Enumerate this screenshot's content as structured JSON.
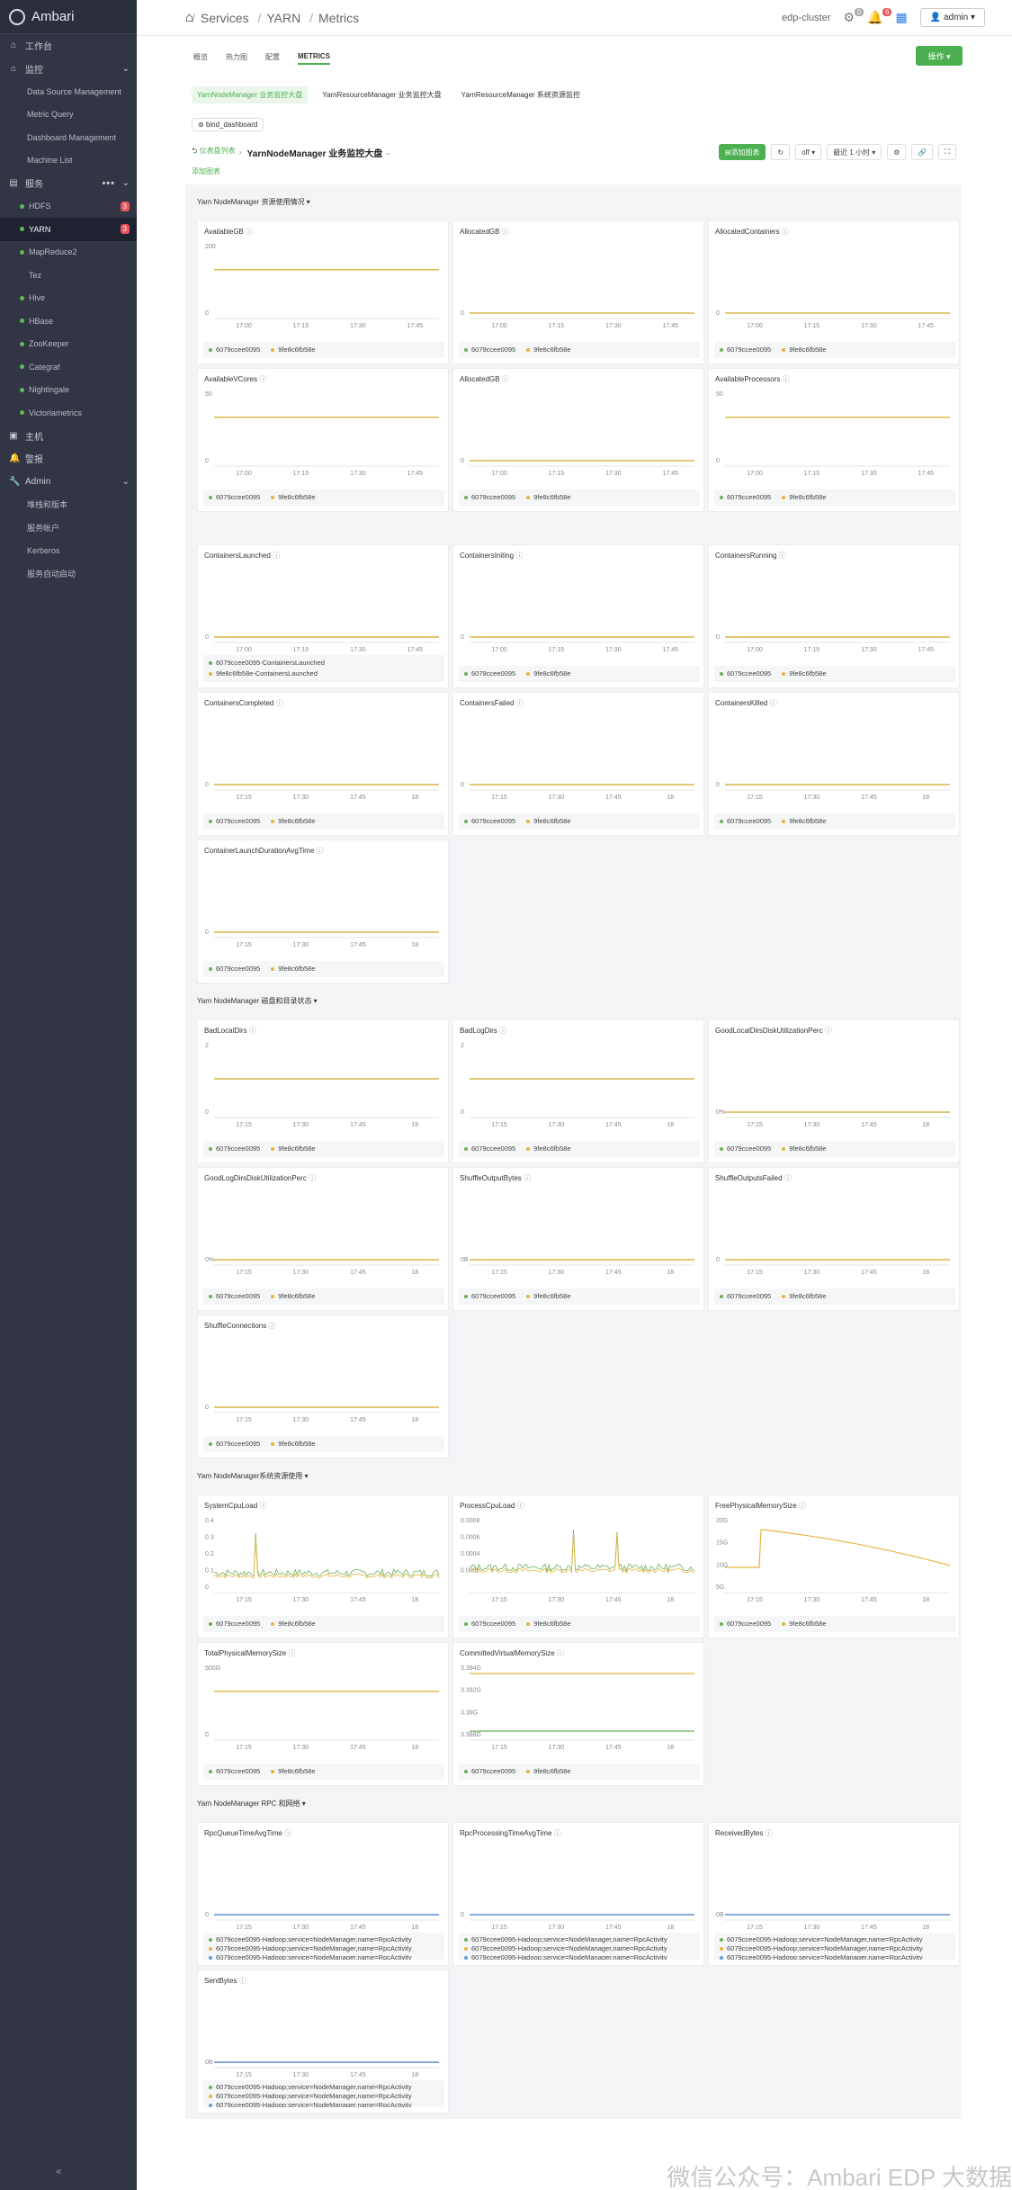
{
  "app": {
    "name": "Ambari"
  },
  "sidebar": {
    "items": [
      {
        "label": "工作台",
        "icon": "dashboard-icon"
      },
      {
        "label": "监控",
        "icon": "home-icon",
        "expanded": true
      },
      {
        "label": "Data Source Management",
        "type": "sub"
      },
      {
        "label": "Metric Query",
        "type": "sub"
      },
      {
        "label": "Dashboard Management",
        "type": "sub"
      },
      {
        "label": "Machine List",
        "type": "sub"
      },
      {
        "label": "服务",
        "icon": "services-icon",
        "expanded": true
      },
      {
        "label": "HDFS",
        "type": "svc",
        "badge": "3"
      },
      {
        "label": "YARN",
        "type": "svc",
        "badge": "3",
        "active": true
      },
      {
        "label": "MapReduce2",
        "type": "svc"
      },
      {
        "label": "Tez",
        "type": "svc",
        "nodot": true
      },
      {
        "label": "Hive",
        "type": "svc"
      },
      {
        "label": "HBase",
        "type": "svc"
      },
      {
        "label": "ZooKeeper",
        "type": "svc"
      },
      {
        "label": "Categraf",
        "type": "svc"
      },
      {
        "label": "Nightingale",
        "type": "svc"
      },
      {
        "label": "Victoriametrics",
        "type": "svc"
      },
      {
        "label": "主机",
        "icon": "host-icon"
      },
      {
        "label": "警报",
        "icon": "alert-icon"
      },
      {
        "label": "Admin",
        "icon": "wrench-icon",
        "expanded": true
      },
      {
        "label": "堆栈和版本",
        "type": "sub"
      },
      {
        "label": "服务帐户",
        "type": "sub"
      },
      {
        "label": "Kerberos",
        "type": "sub"
      },
      {
        "label": "服务自动启动",
        "type": "sub"
      }
    ],
    "collapse": "«"
  },
  "header": {
    "breadcrumb": [
      "Services",
      "YARN",
      "Metrics"
    ],
    "cluster": "edp-cluster",
    "settings_badge": "0",
    "alerts_badge": "6",
    "user": "admin ▾"
  },
  "tabs": [
    "概览",
    "热力图",
    "配置",
    "METRICS"
  ],
  "ops_button": "操作 ▾",
  "subtabs": [
    "YarnNodeManager 业务监控大盘",
    "YarnResourceManager 业务监控大盘",
    "YarnResourceManager 系统资源监控"
  ],
  "bind_tag": "bind_dashboard",
  "dashbar": {
    "back": "仪表盘列表",
    "arrow": "›",
    "title": "YarnNodeManager 业务监控大盘",
    "add_panel": "添加图表",
    "refresh_off": "off ▾",
    "time_range": "最近 1 小时 ▾"
  },
  "add_chart": "添加图表",
  "colors": {
    "series1": "#6fae5a",
    "series2": "#e6b33d",
    "series3": "#5aa0d8",
    "blue_line": "#3f76c4",
    "accent": "#4caf50"
  },
  "groups": [
    {
      "title": "Yarn NodeManager 资源使用情况 ▾"
    },
    {
      "title": "Yarn NodeManager 磁盘和目录状态 ▾"
    },
    {
      "title": "Yarn NodeManager系统资源使用 ▾"
    },
    {
      "title": "Yarn NodeManager RPC 和网络 ▾"
    }
  ],
  "legend_sets": {
    "std": [
      "6079ccee0095",
      "9fe8c6fb58e"
    ],
    "cl": [
      "6079ccee0095-ContainersLaunched",
      "9fe8c6fb58e-ContainersLaunched"
    ],
    "rpc": [
      "6079ccee0095-Hadoop;service=NodeManager,name=RpcActivity",
      "6079ccee0095-Hadoop;service=NodeManager,name=RpcActivity",
      "6079ccee0095-Hadoop;service=NodeManager,name=RpcActivity"
    ]
  },
  "panels": [
    {
      "title": "AvailableGB",
      "y": [
        "200",
        "0"
      ],
      "x": [
        "17:00",
        "17:15",
        "17:30",
        "17:45"
      ],
      "legend": "std",
      "line": 0.35
    },
    {
      "title": "AllocatedGB",
      "y": [
        "",
        "0"
      ],
      "x": [
        "17:00",
        "17:15",
        "17:30",
        "17:45"
      ],
      "legend": "std",
      "line": 1.0
    },
    {
      "title": "AllocatedContainers",
      "y": [
        "",
        "0"
      ],
      "x": [
        "17:00",
        "17:15",
        "17:30",
        "17:45"
      ],
      "legend": "std",
      "line": 1.0
    },
    {
      "title": "AvailableVCores",
      "y": [
        "50",
        "0"
      ],
      "x": [
        "17:00",
        "17:15",
        "17:30",
        "17:45"
      ],
      "legend": "std",
      "line": 0.35
    },
    {
      "title": "AllocatedGB",
      "y": [
        "",
        "0"
      ],
      "x": [
        "17:00",
        "17:15",
        "17:30",
        "17:45"
      ],
      "legend": "std",
      "line": 1.0
    },
    {
      "title": "AvailableProcessors",
      "y": [
        "50",
        "0"
      ],
      "x": [
        "17:00",
        "17:15",
        "17:30",
        "17:45"
      ],
      "legend": "std",
      "line": 0.35
    },
    {
      "title": "ContainersLaunched",
      "y": [
        "",
        "0"
      ],
      "x": [
        "17:00",
        "17:15",
        "17:30",
        "17:45"
      ],
      "legend": "cl",
      "line": 1.0
    },
    {
      "title": "ContainersIniting",
      "y": [
        "",
        "0"
      ],
      "x": [
        "17:00",
        "17:15",
        "17:30",
        "17:45"
      ],
      "legend": "std",
      "line": 1.0
    },
    {
      "title": "ContainersRunning",
      "y": [
        "",
        "0"
      ],
      "x": [
        "17:00",
        "17:15",
        "17:30",
        "17:45"
      ],
      "legend": "std",
      "line": 1.0
    },
    {
      "title": "ContainersCompleted",
      "y": [
        "",
        "0"
      ],
      "x": [
        "17:15",
        "17:30",
        "17:45",
        "18"
      ],
      "legend": "std",
      "line": 1.0
    },
    {
      "title": "ContainersFailed",
      "y": [
        "",
        "0"
      ],
      "x": [
        "17:15",
        "17:30",
        "17:45",
        "18"
      ],
      "legend": "std",
      "line": 1.0
    },
    {
      "title": "ContainersKilled",
      "y": [
        "",
        "0"
      ],
      "x": [
        "17:15",
        "17:30",
        "17:45",
        "18"
      ],
      "legend": "std",
      "line": 1.0
    },
    {
      "title": "ContainerLaunchDurationAvgTime",
      "y": [
        "",
        "0"
      ],
      "x": [
        "17:15",
        "17:30",
        "17:45",
        "18"
      ],
      "legend": "std",
      "line": 1.0
    },
    {
      "title": "BadLocalDirs",
      "y": [
        "2",
        "0"
      ],
      "x": [
        "17:15",
        "17:30",
        "17:45",
        "18"
      ],
      "legend": "std",
      "line": 0.5
    },
    {
      "title": "BadLogDirs",
      "y": [
        "2",
        "0"
      ],
      "x": [
        "17:15",
        "17:30",
        "17:45",
        "18"
      ],
      "legend": "std",
      "line": 0.5
    },
    {
      "title": "GoodLocalDirsDiskUtilizationPerc",
      "y": [
        "",
        "0%"
      ],
      "x": [
        "17:15",
        "17:30",
        "17:45",
        "18"
      ],
      "legend": "std",
      "line": 1.0
    },
    {
      "title": "GoodLogDirsDiskUtilizationPerc",
      "y": [
        "",
        "0%"
      ],
      "x": [
        "17:15",
        "17:30",
        "17:45",
        "18"
      ],
      "legend": "std",
      "line": 1.0
    },
    {
      "title": "ShuffleOutputBytes",
      "y": [
        "",
        "0B"
      ],
      "x": [
        "17:15",
        "17:30",
        "17:45",
        "18"
      ],
      "legend": "std",
      "line": 1.0
    },
    {
      "title": "ShuffleOutputsFailed",
      "y": [
        "",
        "0"
      ],
      "x": [
        "17:15",
        "17:30",
        "17:45",
        "18"
      ],
      "legend": "std",
      "line": 1.0
    },
    {
      "title": "ShuffleConnections",
      "y": [
        "",
        "0"
      ],
      "x": [
        "17:15",
        "17:30",
        "17:45",
        "18"
      ],
      "legend": "std",
      "line": 1.0
    },
    {
      "title": "SystemCpuLoad",
      "y": [
        "0.4",
        "0.3",
        "0.2",
        "0.1",
        "0"
      ],
      "x": [
        "17:15",
        "17:30",
        "17:45",
        "18"
      ],
      "legend": "std",
      "line": "noisy"
    },
    {
      "title": "ProcessCpuLoad",
      "y": [
        "0.0008",
        "0.0006",
        "0.0004",
        "0.0002",
        ""
      ],
      "x": [
        "17:15",
        "17:30",
        "17:45",
        "18"
      ],
      "legend": "std",
      "line": "noisy2"
    },
    {
      "title": "FreePhysicalMemorySize",
      "y": [
        "20G",
        "15G",
        "10G",
        "5G"
      ],
      "x": [
        "17:15",
        "17:30",
        "17:45",
        "18"
      ],
      "legend": "std",
      "line": "decay"
    },
    {
      "title": "TotalPhysicalMemorySize",
      "y": [
        "500G",
        "0"
      ],
      "x": [
        "17:15",
        "17:30",
        "17:45",
        "18"
      ],
      "legend": "std",
      "line": 0.35
    },
    {
      "title": "CommittedVirtualMemorySize",
      "y": [
        "3.394G",
        "3.392G",
        "3.39G",
        "3.388G"
      ],
      "x": [
        "17:15",
        "17:30",
        "17:45",
        "18"
      ],
      "legend": "std",
      "line": "twolines"
    },
    {
      "title": "RpcQueueTimeAvgTime",
      "y": [
        "",
        "0"
      ],
      "x": [
        "17:15",
        "17:30",
        "17:45",
        "18"
      ],
      "legend": "rpc",
      "line": "blue"
    },
    {
      "title": "RpcProcessingTimeAvgTime",
      "y": [
        "",
        "0"
      ],
      "x": [
        "17:15",
        "17:30",
        "17:45",
        "18"
      ],
      "legend": "rpc",
      "line": "blue"
    },
    {
      "title": "ReceivedBytes",
      "y": [
        "",
        "0B"
      ],
      "x": [
        "17:15",
        "17:30",
        "17:45",
        "18"
      ],
      "legend": "rpc",
      "line": "blue"
    },
    {
      "title": "SentBytes",
      "y": [
        "",
        "0B"
      ],
      "x": [
        "17:15",
        "17:30",
        "17:45",
        "18"
      ],
      "legend": "rpc",
      "line": "blue"
    }
  ],
  "watermark": "微信公众号：Ambari EDP 大数据"
}
